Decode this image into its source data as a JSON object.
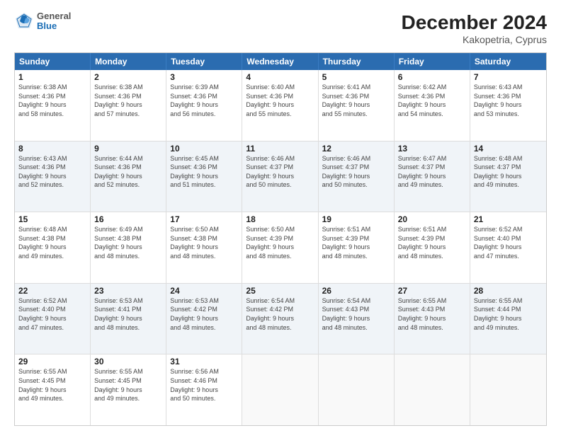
{
  "header": {
    "logo_line1": "General",
    "logo_line2": "Blue",
    "month_year": "December 2024",
    "location": "Kakopetria, Cyprus"
  },
  "days_of_week": [
    "Sunday",
    "Monday",
    "Tuesday",
    "Wednesday",
    "Thursday",
    "Friday",
    "Saturday"
  ],
  "weeks": [
    [
      {
        "day": "1",
        "info": "Sunrise: 6:38 AM\nSunset: 4:36 PM\nDaylight: 9 hours\nand 58 minutes."
      },
      {
        "day": "2",
        "info": "Sunrise: 6:38 AM\nSunset: 4:36 PM\nDaylight: 9 hours\nand 57 minutes."
      },
      {
        "day": "3",
        "info": "Sunrise: 6:39 AM\nSunset: 4:36 PM\nDaylight: 9 hours\nand 56 minutes."
      },
      {
        "day": "4",
        "info": "Sunrise: 6:40 AM\nSunset: 4:36 PM\nDaylight: 9 hours\nand 55 minutes."
      },
      {
        "day": "5",
        "info": "Sunrise: 6:41 AM\nSunset: 4:36 PM\nDaylight: 9 hours\nand 55 minutes."
      },
      {
        "day": "6",
        "info": "Sunrise: 6:42 AM\nSunset: 4:36 PM\nDaylight: 9 hours\nand 54 minutes."
      },
      {
        "day": "7",
        "info": "Sunrise: 6:43 AM\nSunset: 4:36 PM\nDaylight: 9 hours\nand 53 minutes."
      }
    ],
    [
      {
        "day": "8",
        "info": "Sunrise: 6:43 AM\nSunset: 4:36 PM\nDaylight: 9 hours\nand 52 minutes."
      },
      {
        "day": "9",
        "info": "Sunrise: 6:44 AM\nSunset: 4:36 PM\nDaylight: 9 hours\nand 52 minutes."
      },
      {
        "day": "10",
        "info": "Sunrise: 6:45 AM\nSunset: 4:36 PM\nDaylight: 9 hours\nand 51 minutes."
      },
      {
        "day": "11",
        "info": "Sunrise: 6:46 AM\nSunset: 4:37 PM\nDaylight: 9 hours\nand 50 minutes."
      },
      {
        "day": "12",
        "info": "Sunrise: 6:46 AM\nSunset: 4:37 PM\nDaylight: 9 hours\nand 50 minutes."
      },
      {
        "day": "13",
        "info": "Sunrise: 6:47 AM\nSunset: 4:37 PM\nDaylight: 9 hours\nand 49 minutes."
      },
      {
        "day": "14",
        "info": "Sunrise: 6:48 AM\nSunset: 4:37 PM\nDaylight: 9 hours\nand 49 minutes."
      }
    ],
    [
      {
        "day": "15",
        "info": "Sunrise: 6:48 AM\nSunset: 4:38 PM\nDaylight: 9 hours\nand 49 minutes."
      },
      {
        "day": "16",
        "info": "Sunrise: 6:49 AM\nSunset: 4:38 PM\nDaylight: 9 hours\nand 48 minutes."
      },
      {
        "day": "17",
        "info": "Sunrise: 6:50 AM\nSunset: 4:38 PM\nDaylight: 9 hours\nand 48 minutes."
      },
      {
        "day": "18",
        "info": "Sunrise: 6:50 AM\nSunset: 4:39 PM\nDaylight: 9 hours\nand 48 minutes."
      },
      {
        "day": "19",
        "info": "Sunrise: 6:51 AM\nSunset: 4:39 PM\nDaylight: 9 hours\nand 48 minutes."
      },
      {
        "day": "20",
        "info": "Sunrise: 6:51 AM\nSunset: 4:39 PM\nDaylight: 9 hours\nand 48 minutes."
      },
      {
        "day": "21",
        "info": "Sunrise: 6:52 AM\nSunset: 4:40 PM\nDaylight: 9 hours\nand 47 minutes."
      }
    ],
    [
      {
        "day": "22",
        "info": "Sunrise: 6:52 AM\nSunset: 4:40 PM\nDaylight: 9 hours\nand 47 minutes."
      },
      {
        "day": "23",
        "info": "Sunrise: 6:53 AM\nSunset: 4:41 PM\nDaylight: 9 hours\nand 48 minutes."
      },
      {
        "day": "24",
        "info": "Sunrise: 6:53 AM\nSunset: 4:42 PM\nDaylight: 9 hours\nand 48 minutes."
      },
      {
        "day": "25",
        "info": "Sunrise: 6:54 AM\nSunset: 4:42 PM\nDaylight: 9 hours\nand 48 minutes."
      },
      {
        "day": "26",
        "info": "Sunrise: 6:54 AM\nSunset: 4:43 PM\nDaylight: 9 hours\nand 48 minutes."
      },
      {
        "day": "27",
        "info": "Sunrise: 6:55 AM\nSunset: 4:43 PM\nDaylight: 9 hours\nand 48 minutes."
      },
      {
        "day": "28",
        "info": "Sunrise: 6:55 AM\nSunset: 4:44 PM\nDaylight: 9 hours\nand 49 minutes."
      }
    ],
    [
      {
        "day": "29",
        "info": "Sunrise: 6:55 AM\nSunset: 4:45 PM\nDaylight: 9 hours\nand 49 minutes."
      },
      {
        "day": "30",
        "info": "Sunrise: 6:55 AM\nSunset: 4:45 PM\nDaylight: 9 hours\nand 49 minutes."
      },
      {
        "day": "31",
        "info": "Sunrise: 6:56 AM\nSunset: 4:46 PM\nDaylight: 9 hours\nand 50 minutes."
      },
      {
        "day": "",
        "info": ""
      },
      {
        "day": "",
        "info": ""
      },
      {
        "day": "",
        "info": ""
      },
      {
        "day": "",
        "info": ""
      }
    ]
  ]
}
